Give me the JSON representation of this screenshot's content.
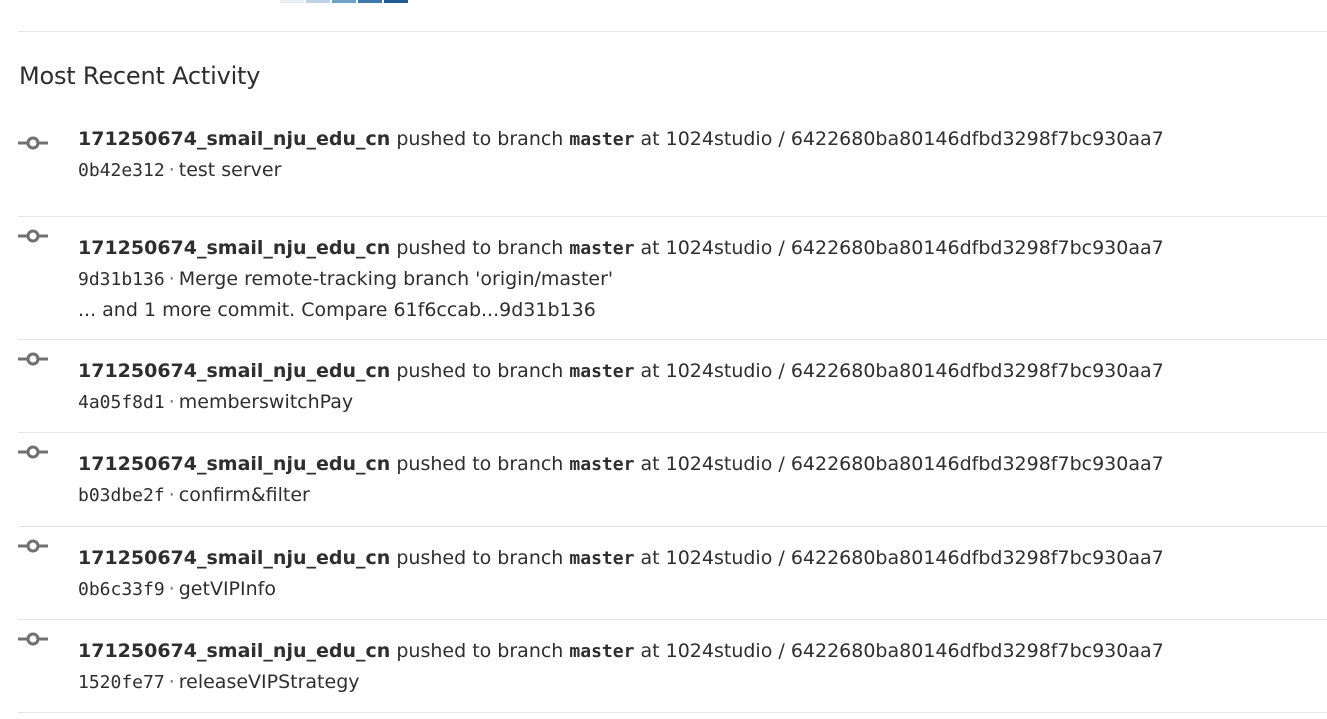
{
  "top_strip_colors": [
    "#e8eef4",
    "#bcd3e6",
    "#6fa0c8",
    "#3f79aa",
    "#1f5a93"
  ],
  "section": {
    "title": "Most Recent Activity"
  },
  "events": [
    {
      "user": "171250674_smail_nju_edu_cn",
      "action": "pushed to branch",
      "branch": "master",
      "at": "at",
      "project": "1024studio / 6422680ba80146dfbd3298f7bc930aa7",
      "sha": "0b42e312",
      "separator": "·",
      "message": "test server",
      "more": ""
    },
    {
      "user": "171250674_smail_nju_edu_cn",
      "action": "pushed to branch",
      "branch": "master",
      "at": "at",
      "project": "1024studio / 6422680ba80146dfbd3298f7bc930aa7",
      "sha": "9d31b136",
      "separator": "·",
      "message": "Merge remote-tracking branch 'origin/master'",
      "more": "... and 1 more commit.",
      "compare": "Compare 61f6ccab...9d31b136"
    },
    {
      "user": "171250674_smail_nju_edu_cn",
      "action": "pushed to branch",
      "branch": "master",
      "at": "at",
      "project": "1024studio / 6422680ba80146dfbd3298f7bc930aa7",
      "sha": "4a05f8d1",
      "separator": "·",
      "message": "memberswitchPay",
      "more": ""
    },
    {
      "user": "171250674_smail_nju_edu_cn",
      "action": "pushed to branch",
      "branch": "master",
      "at": "at",
      "project": "1024studio / 6422680ba80146dfbd3298f7bc930aa7",
      "sha": "b03dbe2f",
      "separator": "·",
      "message": "confirm&filter",
      "more": ""
    },
    {
      "user": "171250674_smail_nju_edu_cn",
      "action": "pushed to branch",
      "branch": "master",
      "at": "at",
      "project": "1024studio / 6422680ba80146dfbd3298f7bc930aa7",
      "sha": "0b6c33f9",
      "separator": "·",
      "message": "getVIPInfo",
      "more": ""
    },
    {
      "user": "171250674_smail_nju_edu_cn",
      "action": "pushed to branch",
      "branch": "master",
      "at": "at",
      "project": "1024studio / 6422680ba80146dfbd3298f7bc930aa7",
      "sha": "1520fe77",
      "separator": "·",
      "message": "releaseVIPStrategy",
      "more": ""
    }
  ],
  "icons": {
    "event": "commit-icon"
  }
}
